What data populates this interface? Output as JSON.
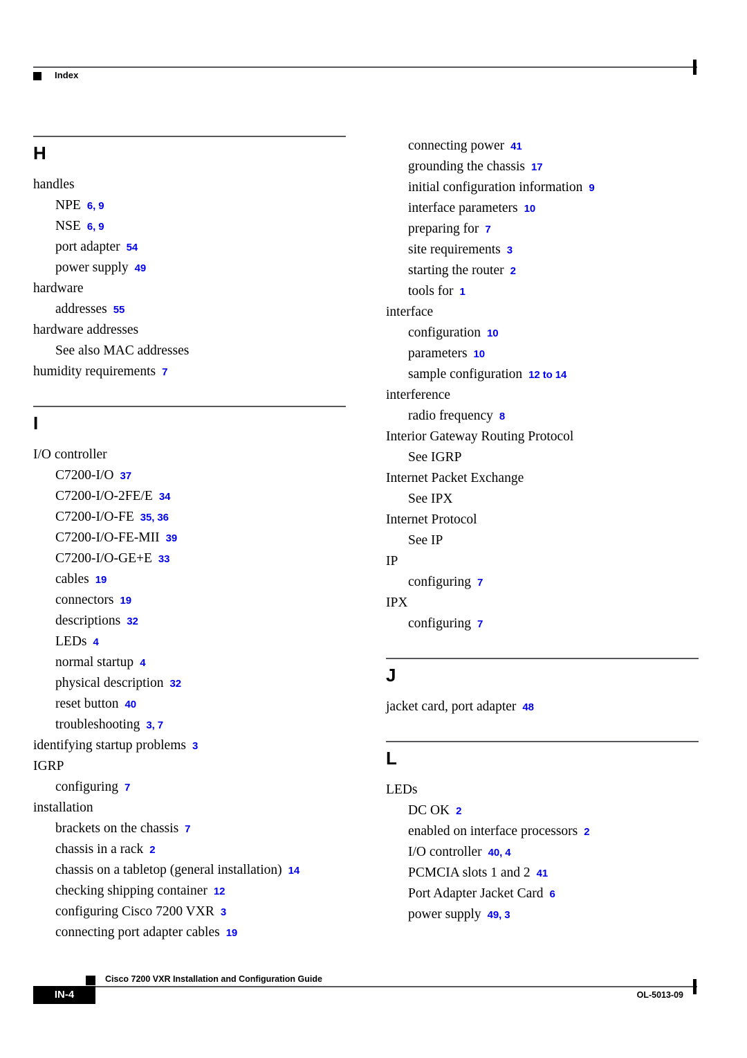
{
  "header": {
    "bullet_icon": "square-bullet-icon",
    "title": "Index"
  },
  "footer": {
    "page_number": "IN-4",
    "bullet_icon": "square-bullet-icon",
    "document_title": "Cisco 7200 VXR Installation and Configuration Guide",
    "document_id": "OL-5013-09"
  },
  "colors": {
    "page_number_link": "#0000ee",
    "rule": "#58585a",
    "text": "#000000"
  },
  "columns": [
    {
      "name": "left-column",
      "blocks": [
        {
          "type": "letter",
          "letter": "H",
          "entries": [
            {
              "level": 1,
              "text": "handles",
              "pages": ""
            },
            {
              "level": 2,
              "text": "NPE",
              "pages": "6, 9"
            },
            {
              "level": 2,
              "text": "NSE",
              "pages": "6, 9"
            },
            {
              "level": 2,
              "text": "port adapter",
              "pages": "54"
            },
            {
              "level": 2,
              "text": "power supply",
              "pages": "49"
            },
            {
              "level": 1,
              "text": "hardware",
              "pages": ""
            },
            {
              "level": 2,
              "text": "addresses",
              "pages": "55"
            },
            {
              "level": 1,
              "text": "hardware addresses",
              "pages": ""
            },
            {
              "level": 2,
              "text": "See also MAC addresses",
              "pages": ""
            },
            {
              "level": 1,
              "text": "humidity requirements",
              "pages": "7"
            }
          ]
        },
        {
          "type": "letter",
          "letter": "I",
          "entries": [
            {
              "level": 1,
              "text": "I/O controller",
              "pages": ""
            },
            {
              "level": 2,
              "text": "C7200-I/O",
              "pages": "37"
            },
            {
              "level": 2,
              "text": "C7200-I/O-2FE/E",
              "pages": "34"
            },
            {
              "level": 2,
              "text": "C7200-I/O-FE",
              "pages": "35, 36"
            },
            {
              "level": 2,
              "text": "C7200-I/O-FE-MII",
              "pages": "39"
            },
            {
              "level": 2,
              "text": "C7200-I/O-GE+E",
              "pages": "33"
            },
            {
              "level": 2,
              "text": "cables",
              "pages": "19"
            },
            {
              "level": 2,
              "text": "connectors",
              "pages": "19"
            },
            {
              "level": 2,
              "text": "descriptions",
              "pages": "32"
            },
            {
              "level": 2,
              "text": "LEDs",
              "pages": "4"
            },
            {
              "level": 2,
              "text": "normal startup",
              "pages": "4"
            },
            {
              "level": 2,
              "text": "physical description",
              "pages": "32"
            },
            {
              "level": 2,
              "text": "reset button",
              "pages": "40"
            },
            {
              "level": 2,
              "text": "troubleshooting",
              "pages": "3, 7"
            },
            {
              "level": 1,
              "text": "identifying startup problems",
              "pages": "3"
            },
            {
              "level": 1,
              "text": "IGRP",
              "pages": ""
            },
            {
              "level": 2,
              "text": "configuring",
              "pages": "7"
            },
            {
              "level": 1,
              "text": "installation",
              "pages": ""
            },
            {
              "level": 2,
              "text": "brackets on the chassis",
              "pages": "7"
            },
            {
              "level": 2,
              "text": "chassis in a rack",
              "pages": "2"
            },
            {
              "level": 2,
              "text": "chassis on a tabletop (general installation)",
              "pages": "14"
            },
            {
              "level": 2,
              "text": "checking shipping container",
              "pages": "12"
            },
            {
              "level": 2,
              "text": "configuring Cisco 7200 VXR",
              "pages": "3"
            },
            {
              "level": 2,
              "text": "connecting port adapter cables",
              "pages": "19"
            }
          ]
        }
      ]
    },
    {
      "name": "right-column",
      "blocks": [
        {
          "type": "continuation",
          "letter": "",
          "entries": [
            {
              "level": 2,
              "text": "connecting power",
              "pages": "41"
            },
            {
              "level": 2,
              "text": "grounding the chassis",
              "pages": "17"
            },
            {
              "level": 2,
              "text": "initial configuration information",
              "pages": "9"
            },
            {
              "level": 2,
              "text": "interface parameters",
              "pages": "10"
            },
            {
              "level": 2,
              "text": "preparing for",
              "pages": "7"
            },
            {
              "level": 2,
              "text": "site requirements",
              "pages": "3"
            },
            {
              "level": 2,
              "text": "starting the router",
              "pages": "2"
            },
            {
              "level": 2,
              "text": "tools for",
              "pages": "1"
            },
            {
              "level": 1,
              "text": "interface",
              "pages": ""
            },
            {
              "level": 2,
              "text": "configuration",
              "pages": "10"
            },
            {
              "level": 2,
              "text": "parameters",
              "pages": "10"
            },
            {
              "level": 2,
              "text": "sample configuration",
              "pages": "12 to 14"
            },
            {
              "level": 1,
              "text": "interference",
              "pages": ""
            },
            {
              "level": 2,
              "text": "radio frequency",
              "pages": "8"
            },
            {
              "level": 1,
              "text": "Interior Gateway Routing Protocol",
              "pages": ""
            },
            {
              "level": 2,
              "text": "See IGRP",
              "pages": ""
            },
            {
              "level": 1,
              "text": "Internet Packet Exchange",
              "pages": ""
            },
            {
              "level": 2,
              "text": "See IPX",
              "pages": ""
            },
            {
              "level": 1,
              "text": "Internet Protocol",
              "pages": ""
            },
            {
              "level": 2,
              "text": "See IP",
              "pages": ""
            },
            {
              "level": 1,
              "text": "IP",
              "pages": ""
            },
            {
              "level": 2,
              "text": "configuring",
              "pages": "7"
            },
            {
              "level": 1,
              "text": "IPX",
              "pages": ""
            },
            {
              "level": 2,
              "text": "configuring",
              "pages": "7"
            }
          ]
        },
        {
          "type": "letter",
          "letter": "J",
          "entries": [
            {
              "level": 1,
              "text": "jacket card, port adapter",
              "pages": "48"
            }
          ]
        },
        {
          "type": "letter",
          "letter": "L",
          "entries": [
            {
              "level": 1,
              "text": "LEDs",
              "pages": ""
            },
            {
              "level": 2,
              "text": "DC OK",
              "pages": "2"
            },
            {
              "level": 2,
              "text": "enabled on interface processors",
              "pages": "2"
            },
            {
              "level": 2,
              "text": "I/O controller",
              "pages": "40, 4"
            },
            {
              "level": 2,
              "text": "PCMCIA slots 1 and 2",
              "pages": "41"
            },
            {
              "level": 2,
              "text": "Port Adapter Jacket Card",
              "pages": "6"
            },
            {
              "level": 2,
              "text": "power supply",
              "pages": "49, 3"
            }
          ]
        }
      ]
    }
  ]
}
